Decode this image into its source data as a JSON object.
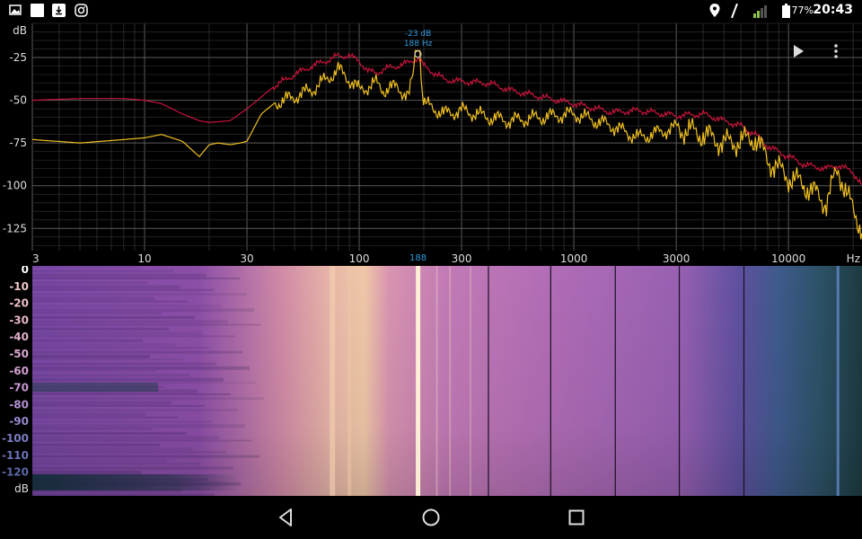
{
  "status_bar": {
    "time": "20:43",
    "battery": "77%",
    "left_icons": [
      "gallery-icon",
      "white-square-icon",
      "download-notification-icon",
      "instagram-icon"
    ],
    "right_icons": [
      "location-icon",
      "data-icon",
      "signal-icon",
      "battery-icon"
    ]
  },
  "spectrum": {
    "y_unit": "dB",
    "y_ticks": [
      "-25",
      "-50",
      "-75",
      "-100",
      "-125"
    ],
    "x_ticks": [
      "3",
      "10",
      "30",
      "100",
      "300",
      "1000",
      "3000",
      "10000"
    ],
    "x_unit": "Hz",
    "marker_freq": "188",
    "peak_db_label": "-23 dB",
    "peak_hz_label": "188 Hz",
    "colors": {
      "peak_hold": "#c8143c",
      "current": "#f0c020",
      "marker": "#2f9be0",
      "grid": "#555555"
    }
  },
  "spectrogram": {
    "y_ticks": [
      "0",
      "-10",
      "-20",
      "-30",
      "-40",
      "-50",
      "-60",
      "-70",
      "-80",
      "-90",
      "-100",
      "-110",
      "-120"
    ],
    "y_unit": "dB"
  },
  "chart_data": {
    "type": "line",
    "xscale": "log",
    "xlim": [
      3,
      22000
    ],
    "ylim": [
      -138,
      -5
    ],
    "xlabel": "Hz",
    "ylabel": "dB",
    "series": [
      {
        "color": "#c8143c",
        "x": [
          3,
          5,
          8,
          10,
          12,
          15,
          18,
          20,
          25,
          30,
          40,
          50,
          60,
          70,
          80,
          90,
          100,
          110,
          120,
          130,
          150,
          170,
          188,
          200,
          250,
          300,
          400,
          500,
          700,
          1000,
          1500,
          2000,
          3000,
          4000,
          5000,
          6000,
          7000,
          8000,
          10000,
          12000,
          15000,
          17000,
          20000,
          22000
        ],
        "y": [
          -50,
          -49,
          -49,
          -50,
          -52,
          -58,
          -62,
          -63,
          -62,
          -55,
          -42,
          -35,
          -30,
          -27,
          -24,
          -24,
          -27,
          -33,
          -34,
          -32,
          -30,
          -28,
          -25,
          -30,
          -38,
          -39,
          -40,
          -44,
          -48,
          -52,
          -57,
          -56,
          -59,
          -58,
          -62,
          -65,
          -70,
          -77,
          -83,
          -88,
          -90,
          -88,
          -92,
          -100
        ]
      },
      {
        "color": "#f0c020",
        "x": [
          3,
          5,
          8,
          10,
          12,
          15,
          18,
          20,
          22,
          25,
          28,
          30,
          35,
          40,
          50,
          60,
          70,
          80,
          90,
          100,
          110,
          120,
          130,
          150,
          170,
          188,
          200,
          250,
          300,
          350,
          400,
          500,
          700,
          1000,
          1500,
          2000,
          3000,
          4000,
          5000,
          6000,
          7000,
          8000,
          10000,
          12000,
          15000,
          17000,
          20000,
          22000
        ],
        "y": [
          -73,
          -75,
          -73,
          -72,
          -70,
          -74,
          -83,
          -76,
          -75,
          -76,
          -75,
          -74,
          -58,
          -52,
          -48,
          -44,
          -38,
          -32,
          -38,
          -44,
          -42,
          -40,
          -44,
          -42,
          -48,
          -21,
          -52,
          -58,
          -56,
          -58,
          -60,
          -62,
          -60,
          -58,
          -65,
          -72,
          -66,
          -70,
          -75,
          -74,
          -72,
          -85,
          -95,
          -100,
          -110,
          -90,
          -115,
          -125
        ]
      }
    ],
    "marker": {
      "x": 188,
      "y": -23
    }
  }
}
